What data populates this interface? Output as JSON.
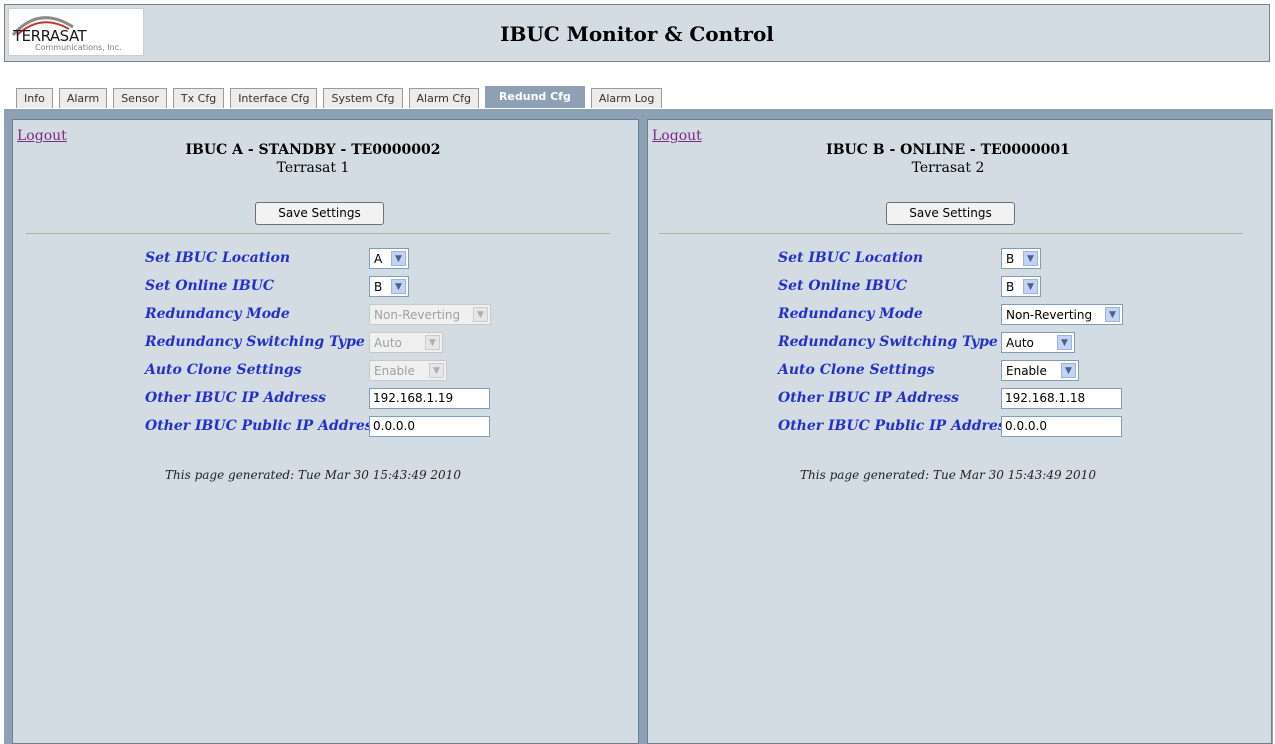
{
  "header": {
    "logo_name": "TERRASAT",
    "logo_sub": "Communications, Inc.",
    "title": "IBUC Monitor & Control"
  },
  "tabs": [
    {
      "label": "Info"
    },
    {
      "label": "Alarm"
    },
    {
      "label": "Sensor"
    },
    {
      "label": "Tx Cfg"
    },
    {
      "label": "Interface Cfg"
    },
    {
      "label": "System Cfg"
    },
    {
      "label": "Alarm Cfg"
    },
    {
      "label": "Redund Cfg",
      "active": true
    },
    {
      "label": "Alarm Log"
    }
  ],
  "panels": [
    {
      "logout": "Logout",
      "title": "IBUC A - STANDBY - TE0000002",
      "subtitle": "Terrasat 1",
      "save": "Save Settings",
      "fields": {
        "location": {
          "label": "Set IBUC Location",
          "value": "A"
        },
        "online": {
          "label": "Set Online IBUC",
          "value": "B"
        },
        "mode": {
          "label": "Redundancy Mode",
          "value": "Non-Reverting",
          "disabled": true
        },
        "switching": {
          "label": "Redundancy Switching Type",
          "value": "Auto",
          "disabled": true
        },
        "clone": {
          "label": "Auto Clone Settings",
          "value": "Enable",
          "disabled": true
        },
        "other_ip": {
          "label": "Other IBUC IP Address",
          "value": "192.168.1.19"
        },
        "public_ip": {
          "label": "Other IBUC Public IP Address",
          "value": "0.0.0.0"
        }
      },
      "footer": "This page generated: Tue Mar 30 15:43:49 2010"
    },
    {
      "logout": "Logout",
      "title": "IBUC B - ONLINE - TE0000001",
      "subtitle": "Terrasat 2",
      "save": "Save Settings",
      "fields": {
        "location": {
          "label": "Set IBUC Location",
          "value": "B"
        },
        "online": {
          "label": "Set Online IBUC",
          "value": "B"
        },
        "mode": {
          "label": "Redundancy Mode",
          "value": "Non-Reverting"
        },
        "switching": {
          "label": "Redundancy Switching Type",
          "value": "Auto"
        },
        "clone": {
          "label": "Auto Clone Settings",
          "value": "Enable"
        },
        "other_ip": {
          "label": "Other IBUC IP Address",
          "value": "192.168.1.18"
        },
        "public_ip": {
          "label": "Other IBUC Public IP Address",
          "value": "0.0.0.0"
        }
      },
      "footer": "This page generated: Tue Mar 30 15:43:49 2010"
    }
  ],
  "icons": {
    "dropdown_arrow": "chevron-down-icon"
  },
  "colors": {
    "label_blue": "#2331c8",
    "panel_bg": "#d3dce3",
    "frame_bg": "#8ea0b4",
    "link_purple": "#7b2a7f"
  }
}
